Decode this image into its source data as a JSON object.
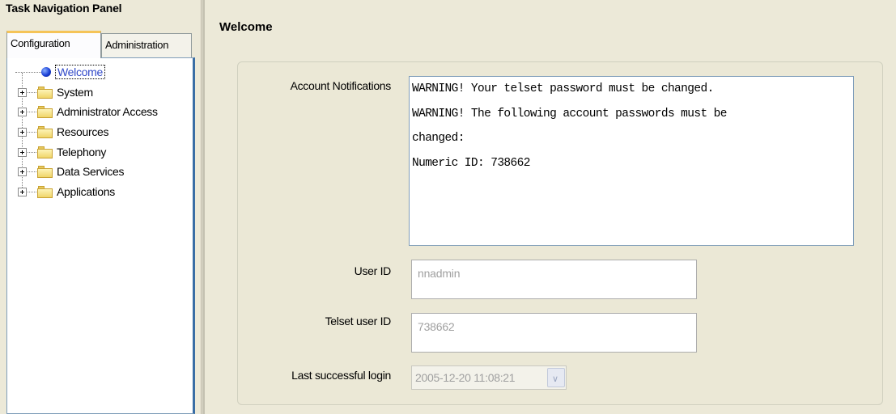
{
  "nav": {
    "title": "Task Navigation Panel",
    "tabs": [
      "Configuration",
      "Administration"
    ],
    "active_tab": "Configuration",
    "tree": [
      {
        "label": "Welcome",
        "icon": "bullet-icon",
        "selected": true
      },
      {
        "label": "System",
        "icon": "folder-icon"
      },
      {
        "label": "Administrator Access",
        "icon": "folder-icon"
      },
      {
        "label": "Resources",
        "icon": "folder-icon"
      },
      {
        "label": "Telephony",
        "icon": "folder-icon"
      },
      {
        "label": "Data Services",
        "icon": "folder-icon"
      },
      {
        "label": "Applications",
        "icon": "folder-icon"
      }
    ]
  },
  "main": {
    "title": "Welcome",
    "account_notifications": {
      "label": "Account Notifications",
      "lines": [
        "WARNING! Your telset password must be changed.",
        "WARNING! The following account passwords must be",
        "changed:",
        "Numeric ID: 738662"
      ]
    },
    "user_id": {
      "label": "User ID",
      "value": "nnadmin"
    },
    "telset_user_id": {
      "label": "Telset user ID",
      "value": "738662"
    },
    "last_login": {
      "label": "Last successful login",
      "value": "2005-12-20 11:08:21"
    }
  },
  "colors": {
    "window_bg": "#ece9d8",
    "tab_highlight": "#f5c458",
    "selection_text": "#3149c8",
    "field_border": "#7f9db9"
  }
}
